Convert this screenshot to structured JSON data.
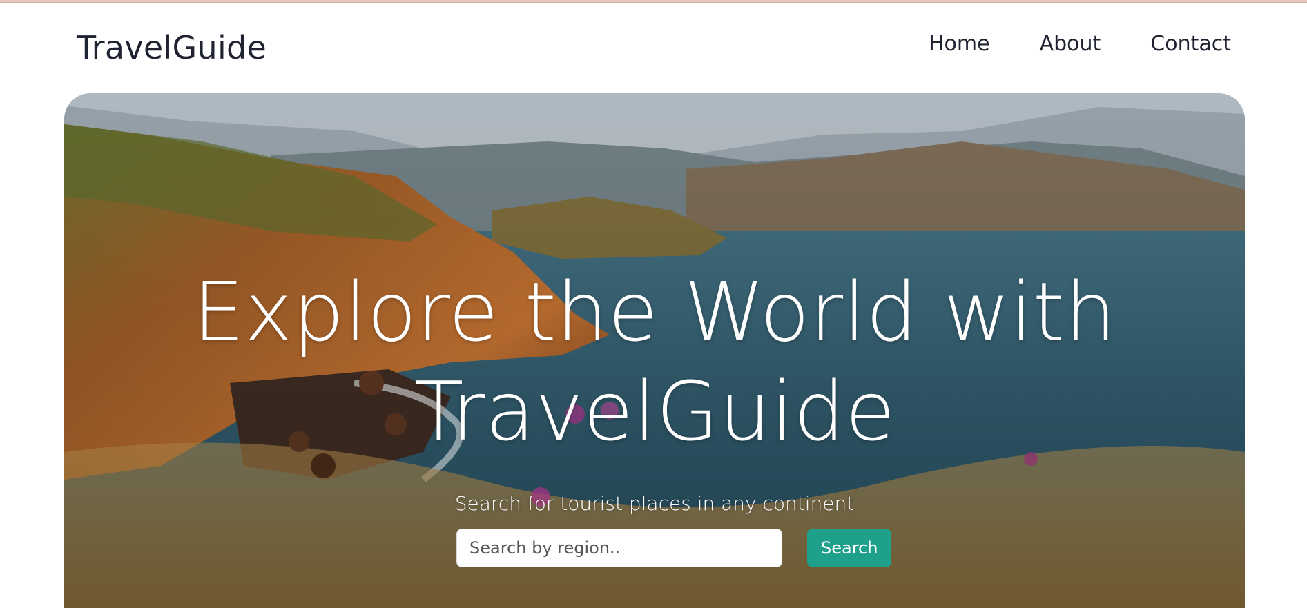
{
  "brand": {
    "name": "TravelGuide"
  },
  "nav": {
    "links": [
      "Home",
      "About",
      "Contact"
    ]
  },
  "hero": {
    "title_line1": "Explore the World with",
    "title_line2": "TravelGuide",
    "subtitle": "Search for tourist places in any continent",
    "search_placeholder": "Search by region..",
    "search_button": "Search"
  },
  "colors": {
    "accent": "#1fa08a",
    "text_dark": "#1f2230"
  }
}
